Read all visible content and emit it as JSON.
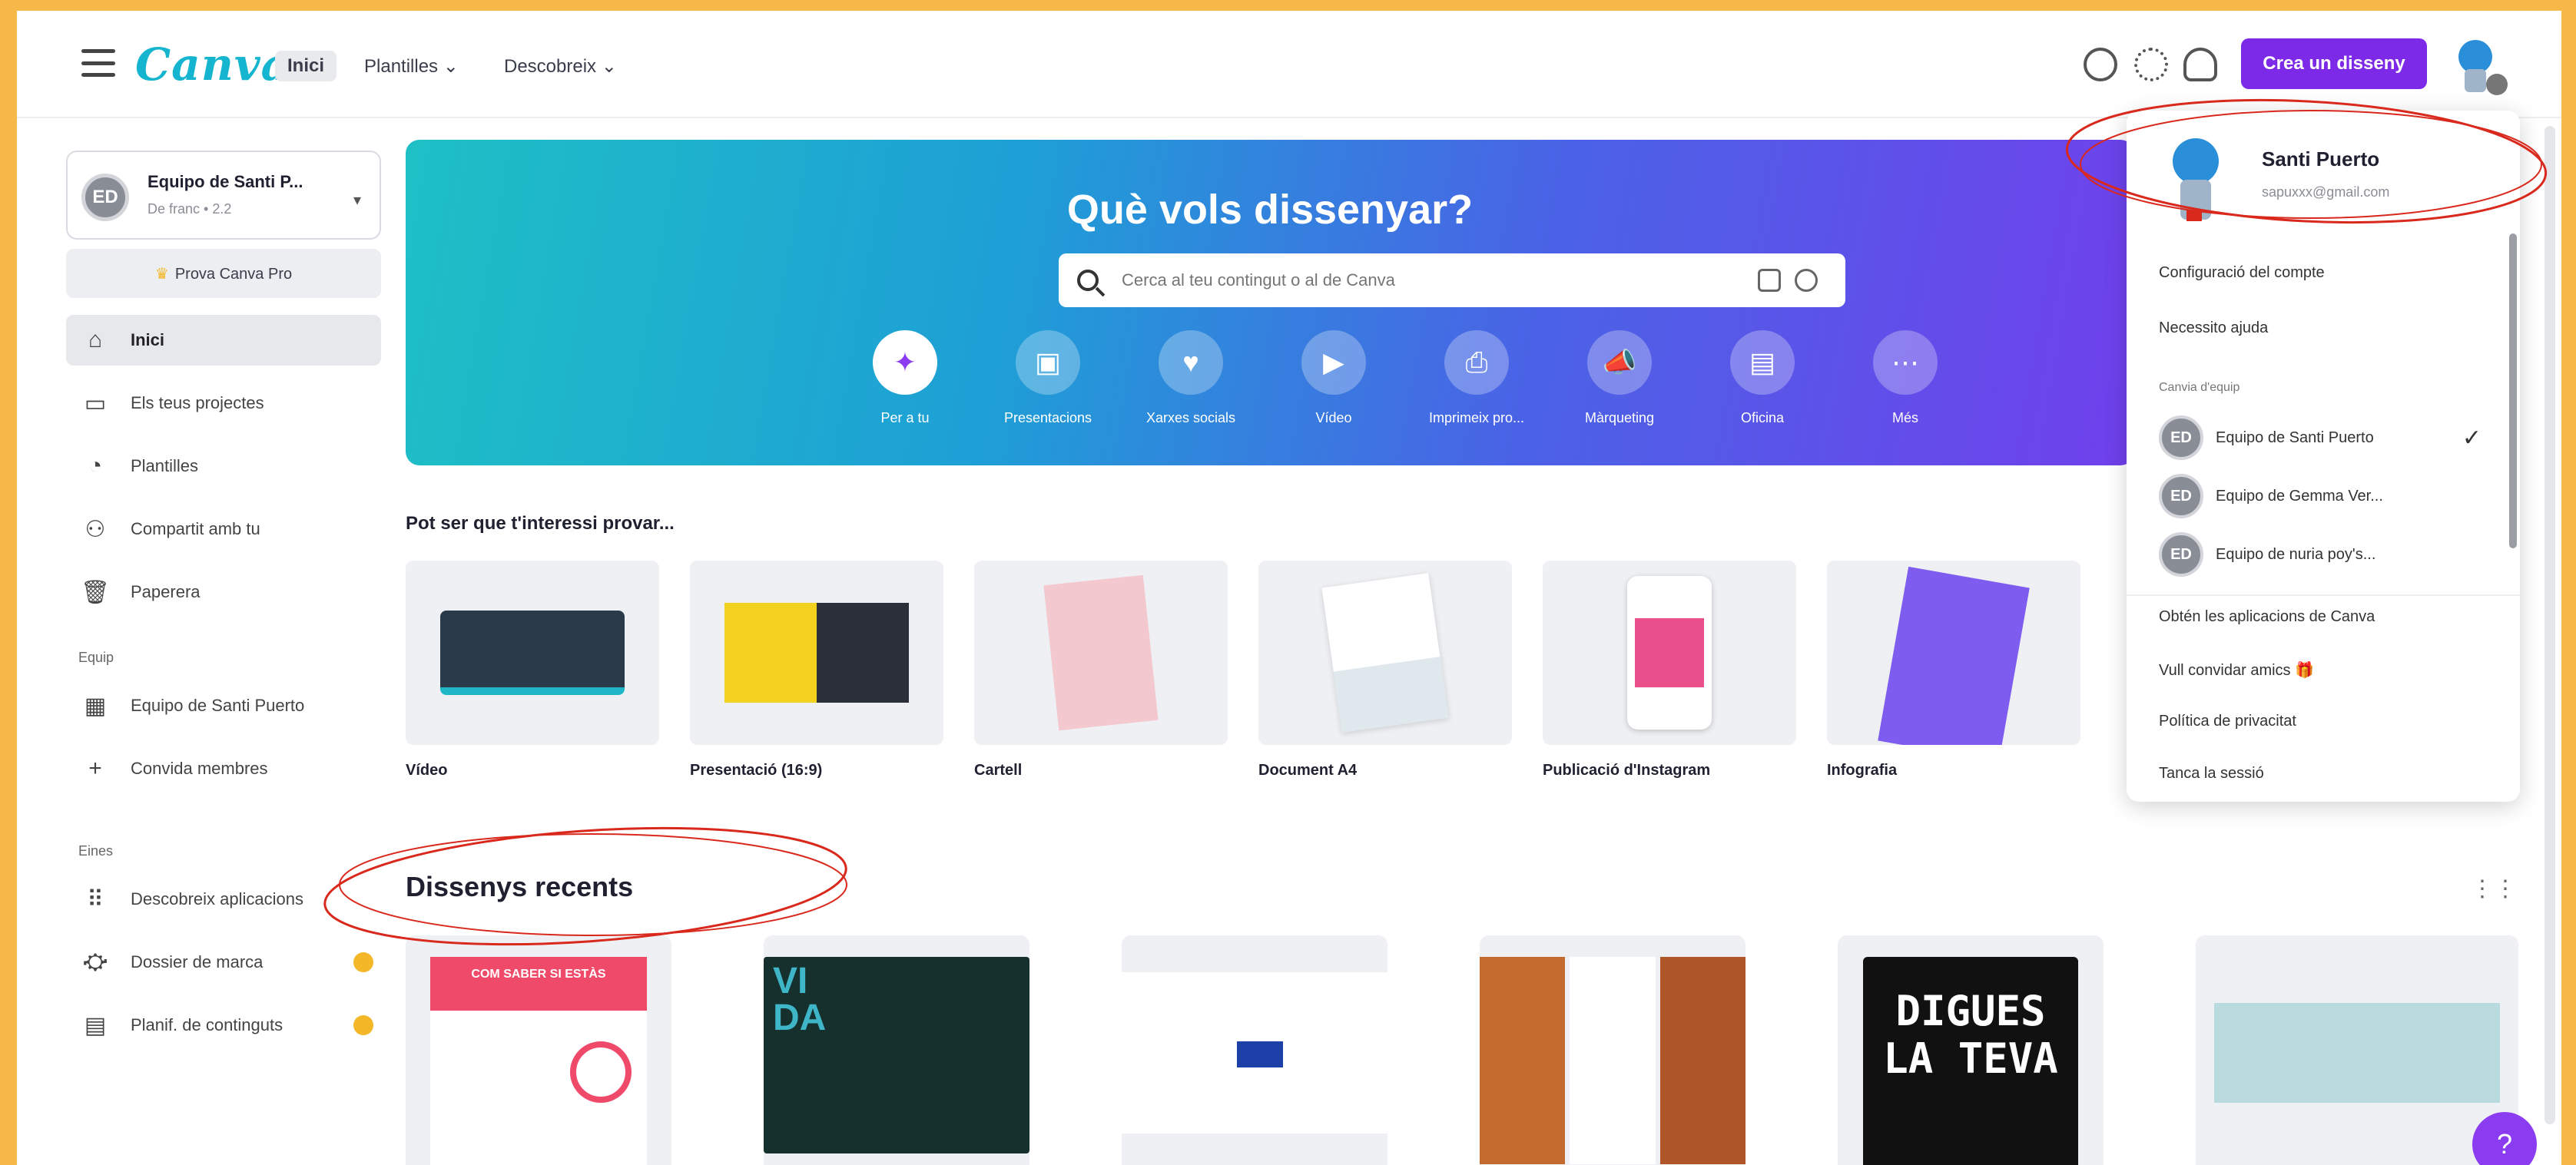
{
  "colors": {
    "accent": "#7d2ae8",
    "brand": "#15b4cf",
    "annotation": "#d9281c",
    "frame": "#f7b84a"
  },
  "topbar": {
    "logo": "Canva",
    "nav": [
      {
        "label": "Inici",
        "active": true
      },
      {
        "label": "Plantilles ⌄"
      },
      {
        "label": "Descobreix ⌄"
      }
    ],
    "icons": [
      "timer-icon",
      "settings-icon",
      "bell-icon"
    ],
    "create_label": "Crea un disseny"
  },
  "sidebar": {
    "team_name": "Equipo de Santi P...",
    "team_sub": "De franc • 2.2",
    "team_initials": "ED",
    "pro_label": "Prova Canva Pro",
    "items": [
      {
        "label": "Inici",
        "icon": "home-icon",
        "glyph": "⌂",
        "active": true
      },
      {
        "label": "Els teus projectes",
        "icon": "folder-icon",
        "glyph": "▭"
      },
      {
        "label": "Plantilles",
        "icon": "templates-icon",
        "glyph": "◔"
      },
      {
        "label": "Compartit amb tu",
        "icon": "shared-icon",
        "glyph": "⚇"
      },
      {
        "label": "Paperera",
        "icon": "trash-icon",
        "glyph": "🗑"
      }
    ],
    "section_team": "Equip",
    "team_items": [
      {
        "label": "Equipo de Santi Puerto",
        "icon": "team-icon",
        "glyph": "▦"
      },
      {
        "label": "Convida membres",
        "icon": "plus-icon",
        "glyph": "+"
      }
    ],
    "section_tools": "Eines",
    "tool_items": [
      {
        "label": "Descobreix aplicacions",
        "icon": "apps-icon",
        "glyph": "⠿"
      },
      {
        "label": "Dossier de marca",
        "icon": "brand-kit-icon",
        "glyph": "⛮",
        "dot": true
      },
      {
        "label": "Planif. de continguts",
        "icon": "calendar-icon",
        "glyph": "▤",
        "dot": true
      }
    ]
  },
  "hero": {
    "title": "Què vols dissenyar?",
    "search_placeholder": "Cerca al teu contingut o al de Canva",
    "categories": [
      {
        "label": "Per a tu",
        "icon": "sparkle-icon",
        "glyph": "✦",
        "selected": true
      },
      {
        "label": "Presentacions",
        "icon": "presentation-icon",
        "glyph": "▣"
      },
      {
        "label": "Xarxes socials",
        "icon": "heart-chat-icon",
        "glyph": "♥"
      },
      {
        "label": "Vídeo",
        "icon": "video-icon",
        "glyph": "▶"
      },
      {
        "label": "Imprimeix pro...",
        "icon": "print-icon",
        "glyph": "⎙"
      },
      {
        "label": "Màrqueting",
        "icon": "megaphone-icon",
        "glyph": "📣"
      },
      {
        "label": "Oficina",
        "icon": "briefcase-icon",
        "glyph": "▤"
      },
      {
        "label": "Més",
        "icon": "more-icon",
        "glyph": "⋯"
      }
    ]
  },
  "suggestions": {
    "title": "Pot ser que t'interessi provar...",
    "items": [
      {
        "label": "Vídeo",
        "color": "#2b3a4a"
      },
      {
        "label": "Presentació (16:9)",
        "color": "#f2d21e"
      },
      {
        "label": "Cartell",
        "color": "#f4c8cf"
      },
      {
        "label": "Document A4",
        "color": "#dfe8ec"
      },
      {
        "label": "Publicació d'Instagram",
        "color": "#e94f8a"
      },
      {
        "label": "Infografia",
        "color": "#7e5cf0"
      }
    ]
  },
  "recent": {
    "title": "Dissenys recents",
    "items": [
      {
        "name": "recent-poster-red",
        "color": "#f04a6a",
        "text": "COM SABER SI ESTÀS"
      },
      {
        "name": "recent-vida-diagram",
        "color": "#16302e",
        "text": "VI DA"
      },
      {
        "name": "recent-mind-map",
        "color": "#ffffff",
        "text": ""
      },
      {
        "name": "recent-food-brochure",
        "color": "#c36a2e",
        "text": ""
      },
      {
        "name": "recent-digues-la-teva",
        "color": "#111111",
        "text": "DIGUES LA TEVA"
      },
      {
        "name": "recent-banner",
        "color": "#b9dbe0",
        "text": ""
      }
    ]
  },
  "dropdown": {
    "user_name": "Santi Puerto",
    "user_email": "sapuxxx@gmail.com",
    "items_top": [
      "Configuració del compte",
      "Necessito ajuda"
    ],
    "teams_section": "Canvia d'equip",
    "teams": [
      {
        "label": "Equipo de Santi Puerto",
        "initials": "ED",
        "checked": true
      },
      {
        "label": "Equipo de Gemma Ver...",
        "initials": "ED"
      },
      {
        "label": "Equipo de nuria poy's...",
        "initials": "ED"
      }
    ],
    "items_bottom": [
      "Obtén les aplicacions de Canva",
      "Vull convidar amics 🎁",
      "Política de privacitat",
      "Tanca la sessió"
    ]
  }
}
